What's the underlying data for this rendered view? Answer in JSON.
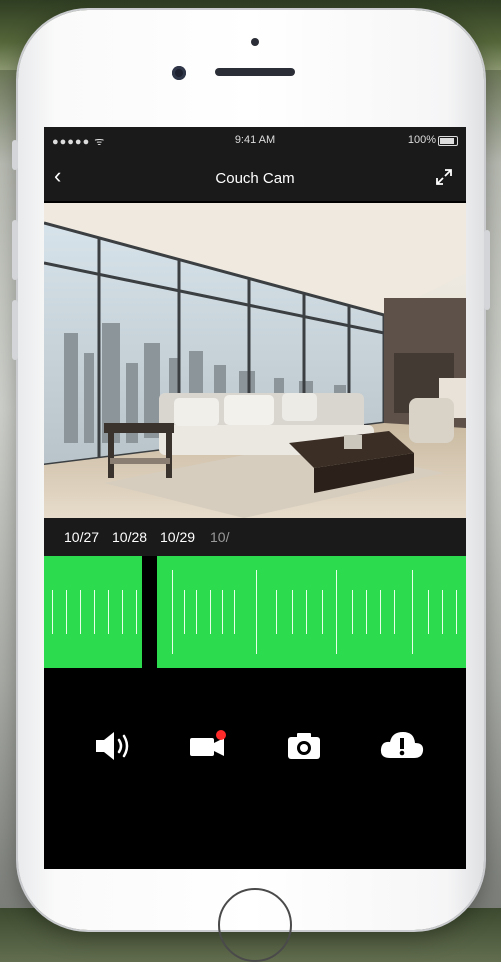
{
  "status_bar": {
    "signal": "●●●●● ᯤ",
    "time": "9:41 AM",
    "battery": "100%"
  },
  "nav": {
    "back": "‹",
    "title": "Couch Cam"
  },
  "timeline": {
    "dates": [
      "10/27",
      "10/28",
      "10/29",
      "10/"
    ],
    "accent_color": "#2ddb4f"
  },
  "controls": [
    {
      "name": "speaker-icon"
    },
    {
      "name": "record-video-icon"
    },
    {
      "name": "camera-snapshot-icon"
    },
    {
      "name": "cloud-alert-icon"
    }
  ]
}
